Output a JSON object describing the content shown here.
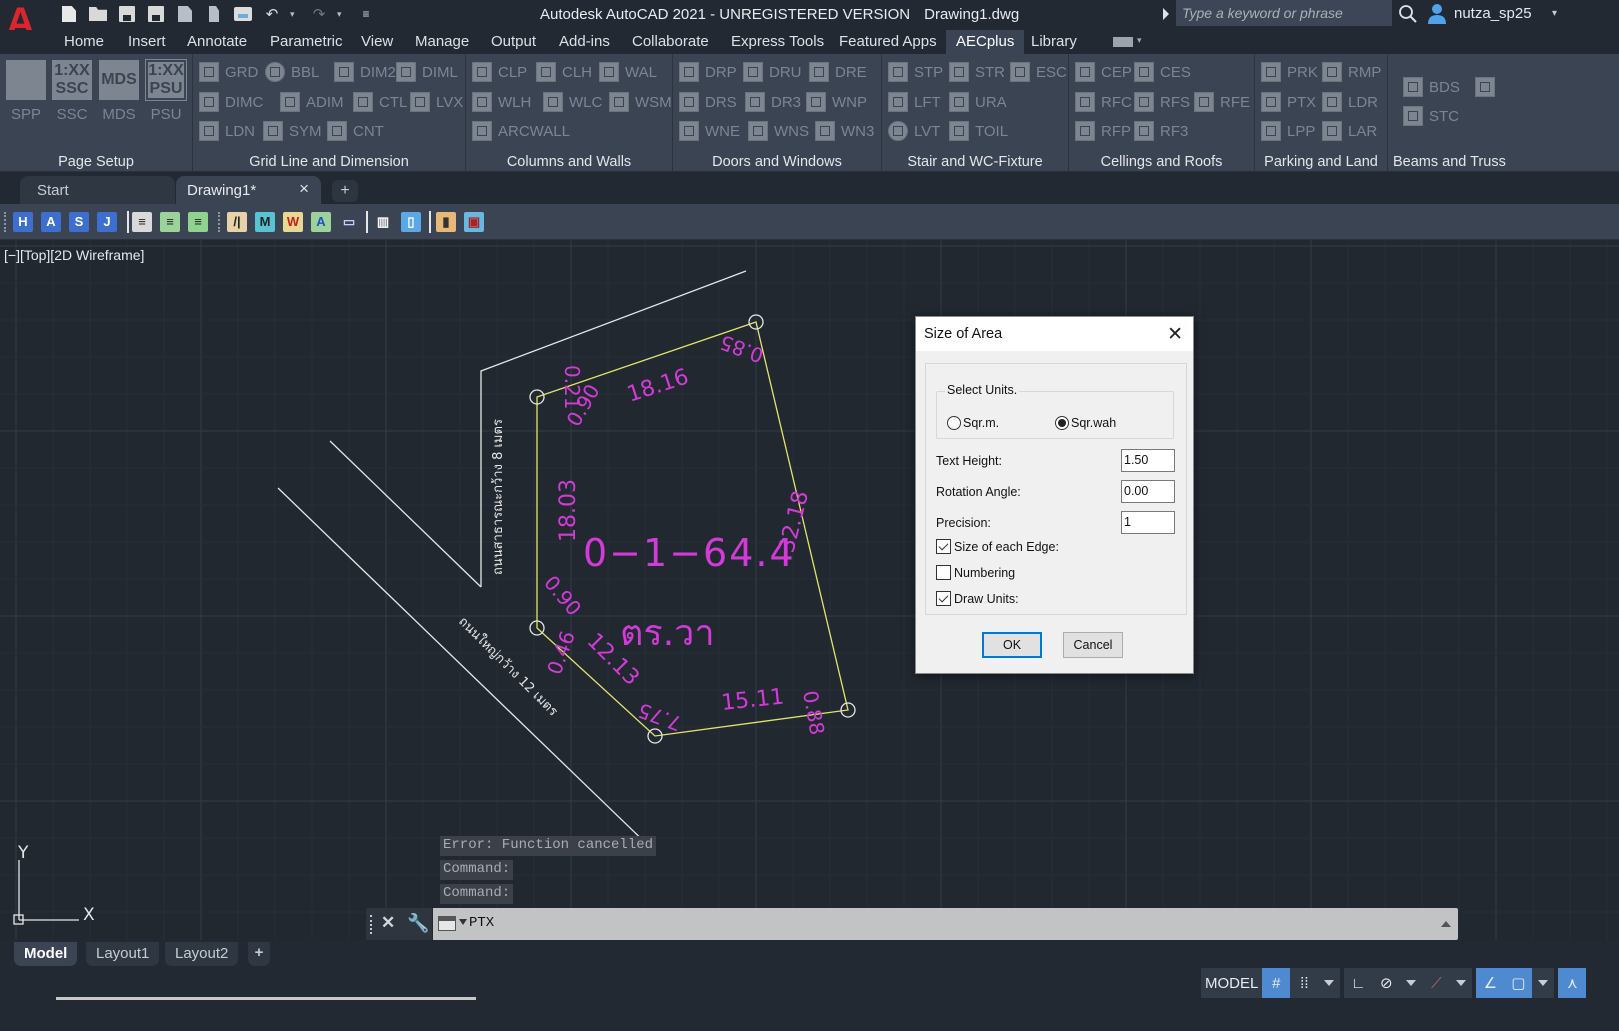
{
  "app": {
    "title": "Autodesk AutoCAD 2021 - UNREGISTERED VERSION",
    "filename": "Drawing1.dwg",
    "logo": "A",
    "search_placeholder": "Type a keyword or phrase",
    "user_name": "nutza_sp25"
  },
  "quick_access": [
    "new-icon",
    "open-icon",
    "save-icon",
    "save-as-icon",
    "open-web-icon",
    "save-web-icon",
    "plot-icon",
    "undo-icon",
    "redo-icon",
    "customize-icon"
  ],
  "ribbon_tabs": [
    "Home",
    "Insert",
    "Annotate",
    "Parametric",
    "View",
    "Manage",
    "Output",
    "Add-ins",
    "Collaborate",
    "Express Tools",
    "Featured Apps",
    "AECplus",
    "Library"
  ],
  "active_ribbon_tab": "AECplus",
  "ribbon_panels": [
    {
      "title": "Page Setup",
      "big_commands": [
        {
          "label": "SPP",
          "icon": ""
        },
        {
          "label": "SSC",
          "icon": "1:XX SSC"
        },
        {
          "label": "MDS",
          "icon": "MDS"
        },
        {
          "label": "PSU",
          "icon": "1:XX PSU"
        }
      ]
    },
    {
      "title": "Grid Line and Dimension",
      "commands": [
        [
          "GRD",
          "BBL",
          "DIM2",
          "DIML"
        ],
        [
          "DIMC",
          "ADIM",
          "CTL",
          "LVX"
        ],
        [
          "LDN",
          "SYM",
          "CNT"
        ]
      ]
    },
    {
      "title": "Columns and Walls",
      "commands": [
        [
          "CLP",
          "CLH",
          "WAL"
        ],
        [
          "WLH",
          "WLC",
          "WSM"
        ],
        [
          "ARCWALL"
        ]
      ]
    },
    {
      "title": "Doors and Windows",
      "commands": [
        [
          "DRP",
          "DRU",
          "DRE"
        ],
        [
          "DRS",
          "DR3",
          "WNP"
        ],
        [
          "WNE",
          "WNS",
          "WN3"
        ]
      ]
    },
    {
      "title": "Stair and WC-Fixture",
      "commands": [
        [
          "STP",
          "STR",
          "ESC"
        ],
        [
          "LFT",
          "URA"
        ],
        [
          "LVT",
          "TOIL"
        ]
      ]
    },
    {
      "title": "Cellings and Roofs",
      "commands": [
        [
          "CEP",
          "CES"
        ],
        [
          "RFC",
          "RFS",
          "RFE"
        ],
        [
          "RFP",
          "RF3"
        ]
      ]
    },
    {
      "title": "Parking and Land",
      "commands": [
        [
          "PRK",
          "RMP"
        ],
        [
          "PTX",
          "LDR"
        ],
        [
          "LPP",
          "LAR"
        ]
      ]
    },
    {
      "title": "Beams and Truss",
      "commands": [
        [
          "BDS",
          ""
        ],
        [
          "STC"
        ]
      ]
    }
  ],
  "doc_tabs": {
    "start": "Start",
    "drawing": "Drawing1*",
    "close": "×",
    "add": "+"
  },
  "toolbar_buttons": [
    {
      "label": "H",
      "bg": "#3c6fcf",
      "fg": "#ffffff"
    },
    {
      "label": "A",
      "bg": "#3c6fcf",
      "fg": "#ffffff"
    },
    {
      "label": "S",
      "bg": "#3c6fcf",
      "fg": "#ffffff"
    },
    {
      "label": "J",
      "bg": "#3c6fcf",
      "fg": "#ffffff"
    },
    {
      "label": "≡",
      "bg": "#d9d9d9",
      "fg": "#222222"
    },
    {
      "label": "≡",
      "bg": "#9bd39b",
      "fg": "#222222"
    },
    {
      "label": "≡",
      "bg": "#8fd38f",
      "fg": "#222222"
    },
    {
      "label": "/|",
      "bg": "#e8d2a8",
      "fg": "#222222"
    },
    {
      "label": "M",
      "bg": "#58c3d3",
      "fg": "#222222"
    },
    {
      "label": "W",
      "bg": "#e8d890",
      "fg": "#c02020"
    },
    {
      "label": "A",
      "bg": "#9bd39b",
      "fg": "#2050c0"
    },
    {
      "label": "▭",
      "bg": "#3b4453",
      "fg": "#c8d0ff"
    },
    {
      "label": "▥",
      "bg": "#3b4453",
      "fg": "#ffffff"
    },
    {
      "label": "▯",
      "bg": "#5aa9e6",
      "fg": "#ffffff"
    },
    {
      "label": "▮",
      "bg": "#e8b878",
      "fg": "#333333"
    },
    {
      "label": "▣",
      "bg": "#68b8e0",
      "fg": "#b02020"
    }
  ],
  "viewport_label": "[−][Top][2D Wireframe]",
  "drawing": {
    "area_text": "0−1−64.4",
    "unit_text": "ตร.วา",
    "edge_labels": [
      "18.16",
      "32.18",
      "15.11",
      "12.13",
      "18.03",
      "7.75"
    ],
    "angle_labels": [
      "0.85",
      "0.90",
      "0.21",
      "0.90",
      "0.46",
      "0.88"
    ],
    "road_label_1": "ถนนสาธารณะกว้าง 8 เมตร",
    "road_label_2": "ถนนใหญ่กว้าง 12 เมตร",
    "colors": {
      "boundary": "#e3e46a",
      "labels": "#d23bd8",
      "roads": "#e6e6e6",
      "grid": "#2c3440"
    }
  },
  "ucs": {
    "x": "X",
    "y": "Y"
  },
  "command_history": [
    "Error: Function cancelled",
    "Command:",
    "Command:"
  ],
  "command_line": {
    "value": "PTX"
  },
  "layout_tabs": [
    "Model",
    "Layout1",
    "Layout2",
    "+"
  ],
  "statusbar": {
    "model": "MODEL"
  },
  "dialog": {
    "title": "Size of Area",
    "units_group_label": "Select Units.",
    "units": [
      {
        "label": "Sqr.m.",
        "selected": false
      },
      {
        "label": "Sqr.wah",
        "selected": true
      }
    ],
    "fields": [
      {
        "label": "Text Height:",
        "value": "1.50"
      },
      {
        "label": "Rotation Angle:",
        "value": "0.00"
      },
      {
        "label": "Precision:",
        "value": "1"
      }
    ],
    "checkboxes": [
      {
        "label": "Size of each Edge:",
        "checked": true
      },
      {
        "label": "Numbering",
        "checked": false
      },
      {
        "label": "Draw Units:",
        "checked": true
      }
    ],
    "ok_label": "OK",
    "cancel_label": "Cancel"
  }
}
